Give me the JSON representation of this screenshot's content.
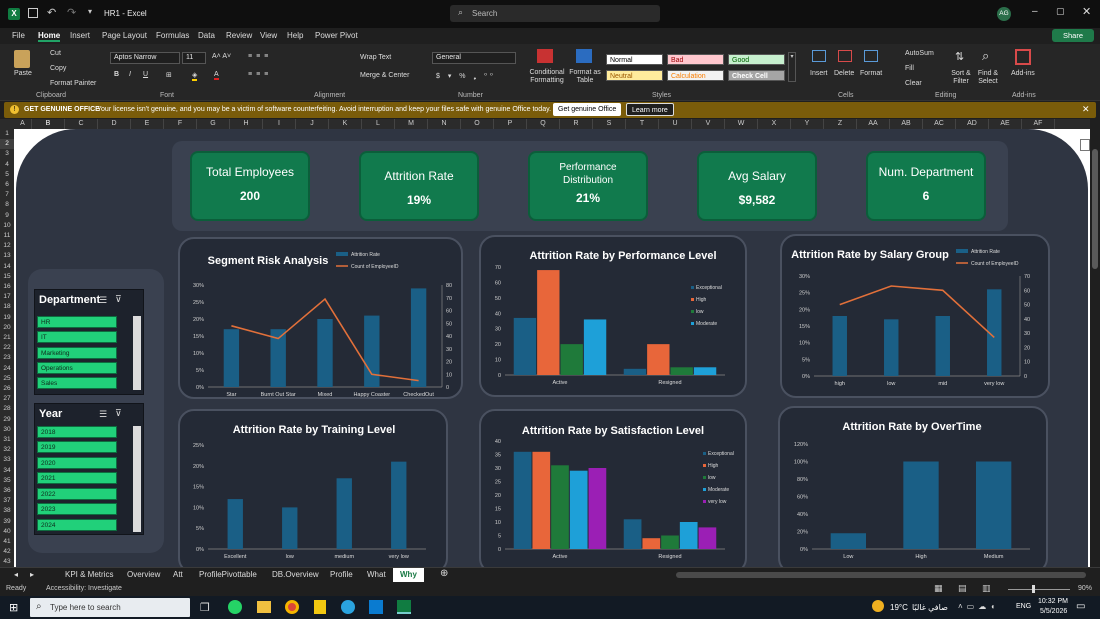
{
  "window": {
    "title": "HR1 - Excel",
    "search_placeholder": "Search",
    "avatar": "AG",
    "share": "Share"
  },
  "menu": [
    "File",
    "Home",
    "Insert",
    "Page Layout",
    "Formulas",
    "Data",
    "Review",
    "View",
    "Help",
    "Power Pivot"
  ],
  "ribbon": {
    "paste": "Paste",
    "cut": "Cut",
    "copy": "Copy",
    "format_painter": "Format Painter",
    "clipboard": "Clipboard",
    "font_name": "Aptos Narrow",
    "font_size": "11",
    "font": "Font",
    "wrap_text": "Wrap Text",
    "merge_center": "Merge & Center",
    "alignment": "Alignment",
    "number_format": "General",
    "number": "Number",
    "cond_fmt": "Conditional Formatting",
    "fmt_table": "Format as Table",
    "styles": {
      "normal": "Normal",
      "bad": "Bad",
      "good": "Good",
      "neutral": "Neutral",
      "calculation": "Calculation",
      "check_cell": "Check Cell",
      "label": "Styles"
    },
    "insert": "Insert",
    "delete": "Delete",
    "format": "Format",
    "cells": "Cells",
    "autosum": "AutoSum",
    "fill": "Fill",
    "clear": "Clear",
    "sort_filter": "Sort & Filter",
    "find_select": "Find & Select",
    "editing": "Editing",
    "addins": "Add-ins",
    "addins_group": "Add-ins"
  },
  "notice": {
    "title": "GET GENUINE OFFICE",
    "text": "Your license isn't genuine, and you may be a victim of software counterfeiting. Avoid interruption and keep your files safe with genuine Office today.",
    "btn1": "Get genuine Office",
    "btn2": "Learn more"
  },
  "columns": [
    "A",
    "B",
    "C",
    "D",
    "E",
    "F",
    "G",
    "H",
    "I",
    "J",
    "K",
    "L",
    "M",
    "N",
    "O",
    "P",
    "Q",
    "R",
    "S",
    "T",
    "U",
    "V",
    "W",
    "X",
    "Y",
    "Z",
    "AA",
    "AB",
    "AC",
    "AD",
    "AE",
    "AF"
  ],
  "kpis": [
    {
      "title": "Total Employees",
      "value": "200"
    },
    {
      "title": "Attrition Rate",
      "value": "19%"
    },
    {
      "title": "Performance Distribution",
      "value": "21%"
    },
    {
      "title": "Avg Salary",
      "value": "$9,582"
    },
    {
      "title": "Num. Department",
      "value": "6"
    }
  ],
  "slicers": {
    "department": {
      "title": "Department",
      "items": [
        "HR",
        "IT",
        "Marketing",
        "Operations",
        "Sales"
      ]
    },
    "year": {
      "title": "Year",
      "items": [
        "2018",
        "2019",
        "2020",
        "2021",
        "2022",
        "2023",
        "2024"
      ]
    }
  },
  "colors": {
    "bar": "#1a5f86",
    "line": "#e2703a",
    "orange": "#e8663a",
    "green": "#1f7a3a",
    "cyan": "#1ea0d8",
    "purple": "#9b1fb5",
    "kpi": "#117a4d",
    "slicer_item": "#21d07a"
  },
  "chart_data": [
    {
      "id": "segment",
      "type": "bar",
      "title": "Segment Risk Analysis",
      "categories": [
        "Star",
        "Burnt Out Star",
        "Mixed",
        "Happy Coaster",
        "CheckedOut"
      ],
      "series": [
        {
          "name": "Attrition Rate",
          "kind": "bar",
          "values": [
            17,
            17,
            20,
            21,
            29
          ]
        },
        {
          "name": "Count of EmployeeID",
          "kind": "line",
          "axis": "right",
          "values": [
            48,
            38,
            69,
            10,
            5
          ]
        }
      ],
      "ylim": [
        0,
        30
      ],
      "yticks": [
        "0%",
        "5%",
        "10%",
        "15%",
        "20%",
        "25%",
        "30%"
      ],
      "y2lim": [
        0,
        80
      ],
      "y2ticks": [
        "0",
        "10",
        "20",
        "30",
        "40",
        "50",
        "60",
        "70",
        "80"
      ]
    },
    {
      "id": "performance",
      "type": "bar",
      "title": "Attrition Rate by Performance Level",
      "categories": [
        "Active",
        "Resigned"
      ],
      "series": [
        {
          "name": "Exceptional",
          "values": [
            37,
            4
          ]
        },
        {
          "name": "High",
          "values": [
            68,
            20
          ]
        },
        {
          "name": "low",
          "values": [
            20,
            5
          ]
        },
        {
          "name": "Moderate",
          "values": [
            36,
            5
          ]
        }
      ],
      "ylim": [
        0,
        70
      ],
      "yticks": [
        "0",
        "10",
        "20",
        "30",
        "40",
        "50",
        "60",
        "70"
      ]
    },
    {
      "id": "salary",
      "type": "bar",
      "title": "Attrition Rate by Salary Group",
      "categories": [
        "high",
        "low",
        "mid",
        "very low"
      ],
      "series": [
        {
          "name": "Attrition Rate",
          "kind": "bar",
          "values": [
            18,
            17,
            18,
            26
          ]
        },
        {
          "name": "Count of EmployeeID",
          "kind": "line",
          "axis": "right",
          "values": [
            50,
            63,
            60,
            27
          ]
        }
      ],
      "ylim": [
        0,
        30
      ],
      "yticks": [
        "0%",
        "5%",
        "10%",
        "15%",
        "20%",
        "25%",
        "30%"
      ],
      "y2lim": [
        0,
        70
      ],
      "y2ticks": [
        "0",
        "10",
        "20",
        "30",
        "40",
        "50",
        "60",
        "70"
      ]
    },
    {
      "id": "training",
      "type": "bar",
      "title": "Attrition Rate by Training Level",
      "categories": [
        "Excellent",
        "low",
        "medium",
        "very low"
      ],
      "series": [
        {
          "name": "Attrition Rate",
          "values": [
            12,
            10,
            17,
            21
          ]
        }
      ],
      "ylim": [
        0,
        25
      ],
      "yticks": [
        "0%",
        "5%",
        "10%",
        "15%",
        "20%",
        "25%"
      ]
    },
    {
      "id": "satisfaction",
      "type": "bar",
      "title": "Attrition Rate by Satisfaction Level",
      "categories": [
        "Active",
        "Resigned"
      ],
      "series": [
        {
          "name": "Exceptional",
          "values": [
            36,
            11
          ]
        },
        {
          "name": "High",
          "values": [
            36,
            4
          ]
        },
        {
          "name": "low",
          "values": [
            31,
            5
          ]
        },
        {
          "name": "Moderate",
          "values": [
            29,
            10
          ]
        },
        {
          "name": "very low",
          "values": [
            30,
            8
          ]
        }
      ],
      "ylim": [
        0,
        40
      ],
      "yticks": [
        "0",
        "5",
        "10",
        "15",
        "20",
        "25",
        "30",
        "35",
        "40"
      ]
    },
    {
      "id": "overtime",
      "type": "bar",
      "title": "Attrition Rate by OverTime",
      "categories": [
        "Low",
        "High",
        "Medium"
      ],
      "series": [
        {
          "name": "Attrition Rate",
          "values": [
            18,
            100,
            100
          ]
        }
      ],
      "ylim": [
        0,
        120
      ],
      "yticks": [
        "0%",
        "20%",
        "40%",
        "60%",
        "80%",
        "100%",
        "120%"
      ]
    }
  ],
  "sheets": [
    "KPI & Metrics",
    "Overview",
    "Att",
    "ProfilePivottable",
    "DB.Overview",
    "Profile",
    "What",
    "Why"
  ],
  "active_sheet": "Why",
  "status": {
    "ready": "Ready",
    "accessibility": "Accessibility: Investigate",
    "zoom": "90%"
  },
  "taskbar": {
    "search": "Type here to search",
    "weather": "19°C",
    "weather_text": "صافي غالبًا",
    "lang": "ENG",
    "time": "10:32 PM",
    "date": "5/5/2026"
  }
}
